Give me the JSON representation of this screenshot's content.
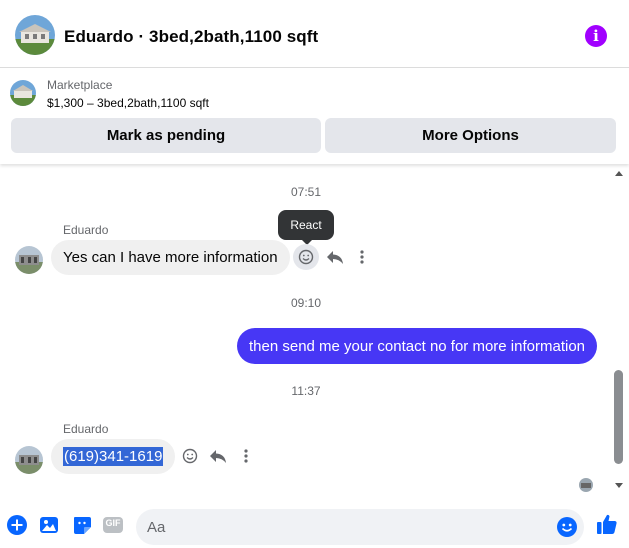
{
  "header": {
    "title": "Eduardo · 3bed,2bath,1100 sqft",
    "info_icon": "info-icon",
    "info_glyph": "i"
  },
  "marketplace": {
    "label": "Marketplace",
    "listing": "$1,300 – 3bed,2bath,1100 sqft",
    "buttons": {
      "pending": "Mark as pending",
      "more": "More Options"
    }
  },
  "conversation": {
    "time1": "07:51",
    "sender1": "Eduardo",
    "msg1": "Yes can I have more information",
    "tooltip": "React",
    "time2": "09:10",
    "msg2": "then send me your contact no for more information",
    "time3": "11:37",
    "sender2": "Eduardo",
    "msg3": "(619)341-1619"
  },
  "composer": {
    "placeholder": "Aa",
    "gif_label": "GIF"
  },
  "colors": {
    "accent": "#0866ff",
    "outgoing_bubble": "#4737f5",
    "info": "#a100ff",
    "incoming_bubble": "#f0f0f0",
    "button_bg": "#e4e6eb"
  }
}
